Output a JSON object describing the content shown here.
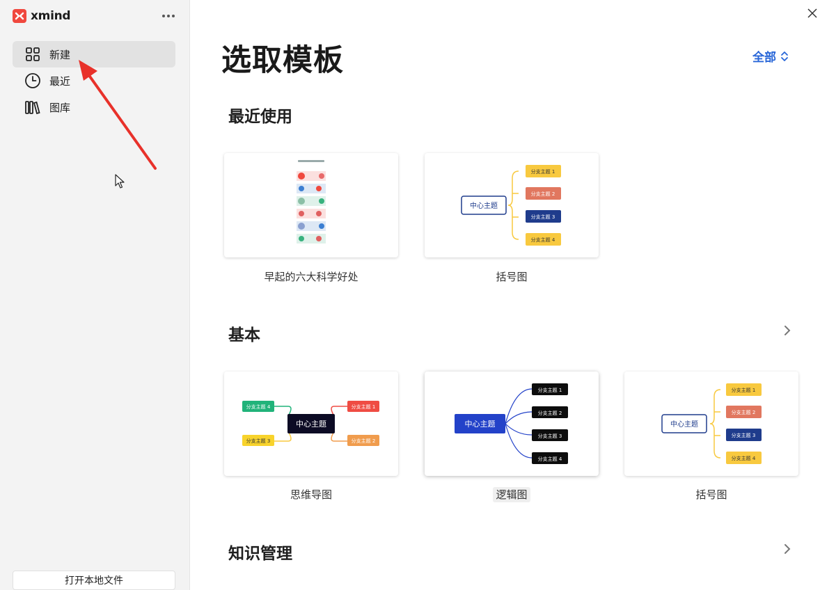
{
  "app": {
    "name": "xmind"
  },
  "sidebar": {
    "items": [
      {
        "label": "新建",
        "icon": "grid-icon",
        "active": true
      },
      {
        "label": "最近",
        "icon": "clock-icon",
        "active": false
      },
      {
        "label": "图库",
        "icon": "library-icon",
        "active": false
      }
    ],
    "open_local": "打开本地文件"
  },
  "main": {
    "title": "选取模板",
    "filter_label": "全部",
    "sections": [
      {
        "title": "最近使用",
        "cards": [
          {
            "label": "早起的六大科学好处"
          },
          {
            "label": "括号图"
          }
        ]
      },
      {
        "title": "基本",
        "cards": [
          {
            "label": "思维导图"
          },
          {
            "label": "逻辑图"
          },
          {
            "label": "括号图"
          }
        ]
      },
      {
        "title": "知识管理"
      }
    ]
  },
  "diagrams": {
    "center": "中心主题",
    "b1": "分支主题 1",
    "b2": "分支主题 2",
    "b3": "分支主题 3",
    "b4": "分支主题 4",
    "b2_alt": "分支主题 2"
  },
  "colors": {
    "accent_blue": "#2866d8",
    "annotation_red": "#e8312a",
    "brand": "#f0483e",
    "yellow_branch": "#f8c93f",
    "orange_branch": "#e1775f",
    "navy_branch": "#1f3c8c",
    "green_branch": "#21b37a",
    "red_branch": "#ef4c43"
  }
}
